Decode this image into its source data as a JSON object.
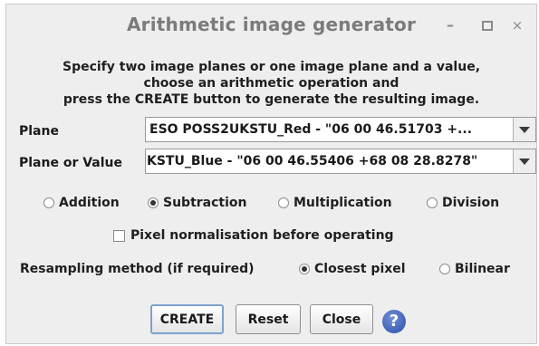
{
  "window": {
    "title": "Arithmetic image generator",
    "min_glyph": "–",
    "close_glyph": "×"
  },
  "instructions": [
    "Specify two image planes or one image plane and a value,",
    "choose an arithmetic operation and",
    "press the CREATE button to generate the resulting image."
  ],
  "plane": {
    "label": "Plane",
    "value": "ESO POSS2UKSTU_Red - \"06 00 46.51703 +..."
  },
  "plane_or_value": {
    "label": "Plane or Value",
    "value": "KSTU_Blue - \"06 00 46.55406 +68 08 28.8278\""
  },
  "operations": {
    "options": [
      "Addition",
      "Subtraction",
      "Multiplication",
      "Division"
    ],
    "selected": "Subtraction"
  },
  "normalisation": {
    "label": "Pixel normalisation before operating",
    "checked": false
  },
  "resampling": {
    "label": "Resampling method (if required)",
    "options": [
      "Closest pixel",
      "Bilinear"
    ],
    "selected": "Closest pixel"
  },
  "buttons": {
    "create": "CREATE",
    "reset": "Reset",
    "close": "Close",
    "help": "?"
  },
  "colors": {
    "help_icon": "#2c4fa8",
    "default_button_border": "#7da2ce",
    "title_text": "#7b7b7b"
  }
}
